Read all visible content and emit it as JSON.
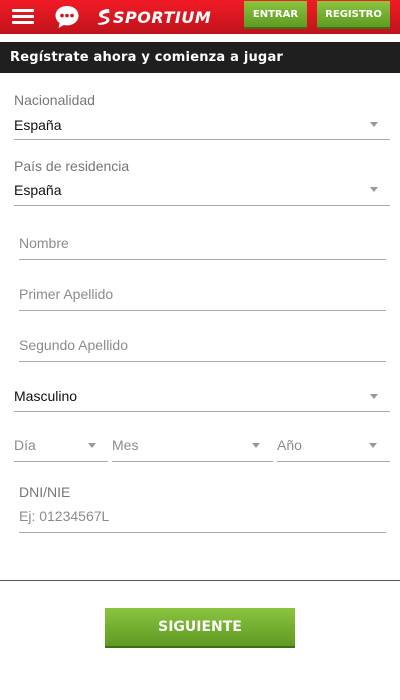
{
  "header": {
    "logo_text": "SPORTIUM",
    "login_label": "ENTRAR",
    "register_label": "REGISTRO",
    "brand_red": "#e0151f",
    "accent_green": "#7ab535"
  },
  "banner": {
    "text": "Regístrate ahora y comienza a jugar"
  },
  "form": {
    "nationality": {
      "label": "Nacionalidad",
      "value": "España"
    },
    "residence": {
      "label": "País de residencia",
      "value": "España"
    },
    "first_name": {
      "placeholder": "Nombre"
    },
    "last_name_1": {
      "placeholder": "Primer Apellido"
    },
    "last_name_2": {
      "placeholder": "Segundo Apellido"
    },
    "gender": {
      "value": "Masculino"
    },
    "birth_day": {
      "placeholder": "Día"
    },
    "birth_month": {
      "placeholder": "Mes"
    },
    "birth_year": {
      "placeholder": "Año"
    },
    "id_document": {
      "label": "DNI/NIE",
      "placeholder": "Ej: 01234567L"
    }
  },
  "next_button": {
    "label": "SIGUIENTE"
  }
}
